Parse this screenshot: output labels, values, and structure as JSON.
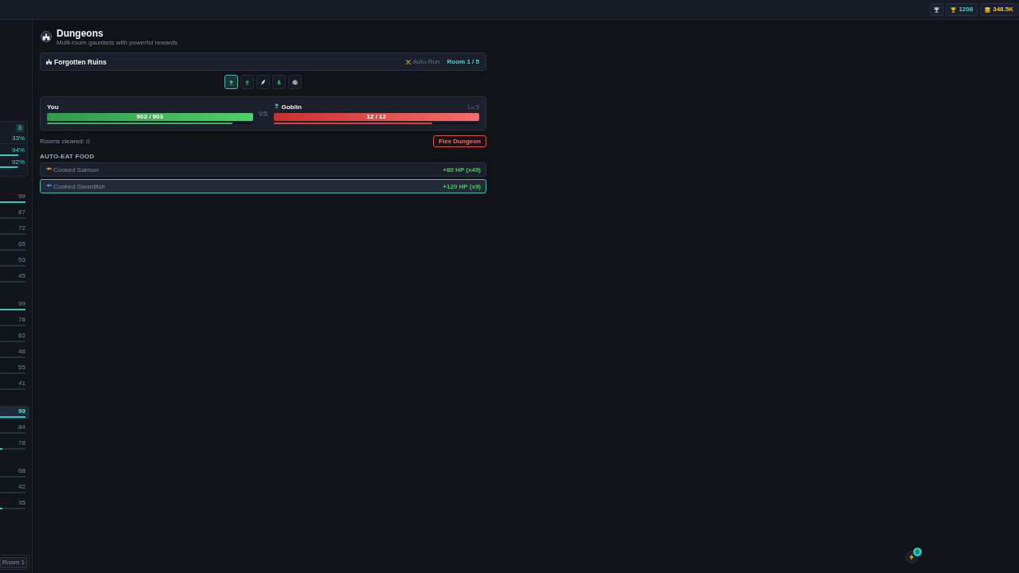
{
  "top_bar": {
    "stats": [
      {
        "kind": "trophies",
        "value": "1208"
      },
      {
        "kind": "gold",
        "value": "348.5K"
      }
    ]
  },
  "sidebar": {
    "summary": {
      "badge": "3",
      "stats": [
        {
          "kind": "plain",
          "value": "33%"
        },
        {
          "kind": "bar",
          "value": "94%",
          "level": 0.94
        },
        {
          "kind": "bar",
          "value": "92%",
          "level": 0.92
        }
      ]
    },
    "groups": [
      {
        "items": [
          {
            "value": "99",
            "level": 1,
            "selected": false
          },
          {
            "value": "87",
            "selected": false
          },
          {
            "value": "72",
            "selected": false
          },
          {
            "value": "65",
            "selected": false
          },
          {
            "value": "53",
            "selected": false
          },
          {
            "value": "45",
            "selected": false
          }
        ]
      },
      {
        "items": [
          {
            "value": "99",
            "level": 1,
            "selected": false
          },
          {
            "value": "78",
            "selected": false
          },
          {
            "value": "62",
            "selected": false
          },
          {
            "value": "48",
            "selected": false
          },
          {
            "value": "55",
            "selected": false
          },
          {
            "value": "41",
            "selected": false
          }
        ]
      },
      {
        "items": [
          {
            "value": "99",
            "level": 1,
            "selected": true
          },
          {
            "value": "84",
            "selected": false
          },
          {
            "value": "78",
            "level": 0.08,
            "selected": false
          }
        ]
      },
      {
        "items": [
          {
            "value": "68",
            "selected": false
          },
          {
            "value": "42",
            "selected": false
          },
          {
            "value": "35",
            "level": 0.08,
            "selected": false
          }
        ]
      }
    ],
    "footer": {
      "label": "Room 1"
    }
  },
  "page": {
    "title": "Dungeons",
    "subtitle": "Multi-room gauntlets with powerful rewards"
  },
  "dungeon": {
    "name": "Forgotten Ruins",
    "auto_run": {
      "label": "Auto-Run",
      "on": false
    },
    "room_counter": "Room 1 / 5"
  },
  "rooms": [
    {
      "current": true
    },
    {
      "current": false
    },
    {
      "current": false
    },
    {
      "current": false
    },
    {
      "current": false
    }
  ],
  "battle": {
    "player": {
      "name": "You",
      "health": {
        "text": "903 / 903",
        "level": 1
      },
      "attack_timer": {
        "level": 0.9
      }
    },
    "separator": "VS",
    "enemy": {
      "name": "Goblin",
      "tier": "Lv.5",
      "health": {
        "text": "12 / 12",
        "level": 1
      },
      "attack_timer": {
        "level": 0.77
      }
    }
  },
  "rooms_cleared": "Rooms cleared: 0",
  "flee_button": "Flee Dungeon",
  "auto_eat": {
    "title": "AUTO-EAT FOOD",
    "items": [
      {
        "name": "Cooked Salmon",
        "effect": "+80 HP (x49)",
        "selected": false
      },
      {
        "name": "Cooked Swordfish",
        "effect": "+120 HP (x9)",
        "selected": true
      }
    ]
  },
  "notifications": {
    "count": "0"
  }
}
